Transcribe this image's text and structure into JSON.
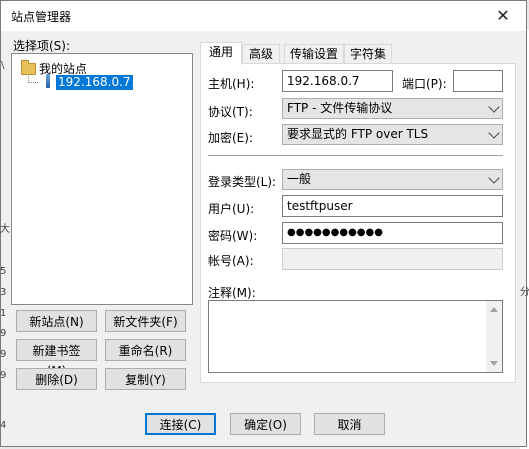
{
  "window": {
    "title": "站点管理器",
    "close_glyph": "✕"
  },
  "left": {
    "select_label": "选择项(S):",
    "tree": {
      "root": "我的站点",
      "child": "192.168.0.7"
    },
    "buttons": {
      "new_site": "新站点(N)",
      "new_folder": "新文件夹(F)",
      "new_bookmark": "新建书签(M)",
      "rename": "重命名(R)",
      "delete": "删除(D)",
      "copy": "复制(Y)"
    }
  },
  "tabs": [
    "通用",
    "高级",
    "传输设置",
    "字符集"
  ],
  "general": {
    "host_label": "主机(H):",
    "host_value": "192.168.0.7",
    "port_label": "端口(P):",
    "port_value": "",
    "protocol_label": "协议(T):",
    "protocol_value": "FTP - 文件传输协议",
    "encryption_label": "加密(E):",
    "encryption_value": "要求显式的 FTP over TLS",
    "logon_type_label": "登录类型(L):",
    "logon_type_value": "一般",
    "user_label": "用户(U):",
    "user_value": "testftpuser",
    "password_label": "密码(W):",
    "password_value": "●●●●●●●●●●●",
    "account_label": "帐号(A):",
    "account_value": "",
    "comments_label": "注释(M):"
  },
  "footer": {
    "connect": "连接(C)",
    "ok": "确定(O)",
    "cancel": "取消"
  },
  "background_fragments": [
    "\\",
    "大",
    "5",
    "3",
    "1",
    "9",
    "9",
    "9",
    "4",
    "分"
  ]
}
